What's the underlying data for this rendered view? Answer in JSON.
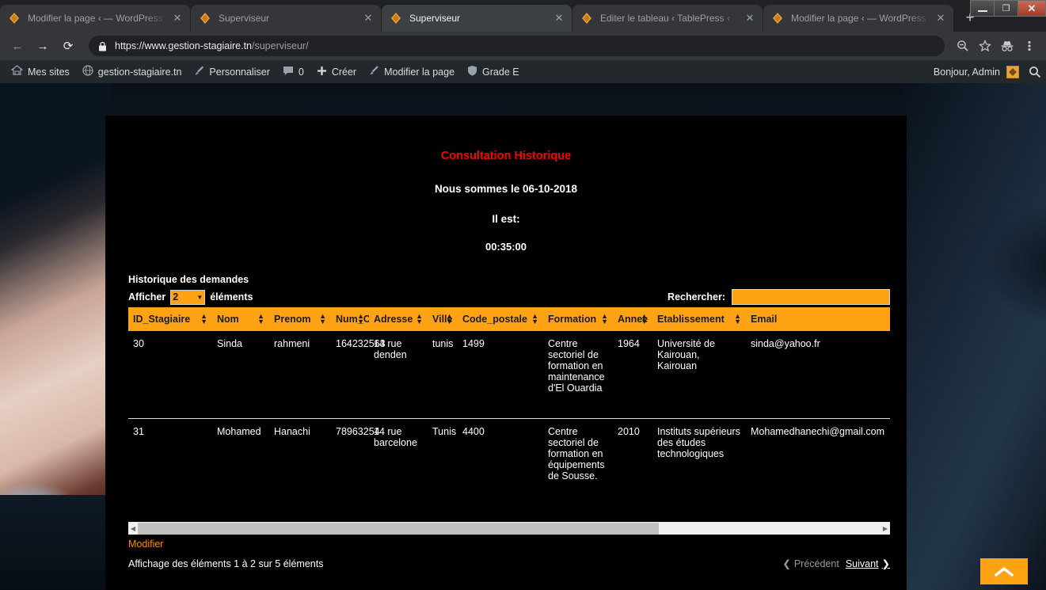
{
  "browser": {
    "tabs": [
      {
        "title": "Modifier la page ‹ — WordPress",
        "active": false,
        "icon": "wordpress-favicon"
      },
      {
        "title": "Superviseur",
        "active": false,
        "icon": "wordpress-favicon"
      },
      {
        "title": "Superviseur",
        "active": true,
        "icon": "wordpress-favicon"
      },
      {
        "title": "Editer le tableau ‹ TablePress ‹",
        "active": false,
        "icon": "wordpress-favicon"
      },
      {
        "title": "Modifier la page ‹ — WordPress",
        "active": false,
        "icon": "wordpress-favicon"
      }
    ],
    "new_tab_label": "+",
    "close_label": "✕",
    "window_controls": {
      "minimize": "—",
      "maximize": "❐",
      "close": "✕"
    },
    "nav": {
      "back": "←",
      "forward": "→",
      "reload": "⟳"
    },
    "url": {
      "scheme_host": "https://www.gestion-stagiaire.tn",
      "path": "/superviseur/"
    },
    "toolbar_icons": [
      "zoom-out-icon",
      "bookmark-star-icon",
      "incognito-icon",
      "chrome-menu-icon"
    ]
  },
  "adminbar": {
    "items": [
      {
        "label": "Mes sites",
        "icon": "wordpress-sites-icon"
      },
      {
        "label": "gestion-stagiaire.tn",
        "icon": "site-icon"
      },
      {
        "label": "Personnaliser",
        "icon": "brush-icon"
      },
      {
        "label": "0",
        "icon": "comment-bubble-icon"
      },
      {
        "label": "Créer",
        "icon": "plus-icon"
      },
      {
        "label": "Modifier la page",
        "icon": "pencil-icon"
      },
      {
        "label": "Grade E",
        "icon": "shield-icon"
      }
    ],
    "greeting": "Bonjour, Admin",
    "avatar_name": "user-avatar",
    "search_icon": "search-icon"
  },
  "page": {
    "title": "Consultation Historique",
    "date_line": "Nous sommes le 06-10-2018",
    "time_label": "Il est:",
    "time_value": "00:35:00",
    "title_color": "#ff0000"
  },
  "table": {
    "caption": "Historique des demandes",
    "length_prefix": "Afficher",
    "length_value": "2",
    "length_suffix": "éléments",
    "search_label": "Rechercher:",
    "search_value": "",
    "search_placeholder": "",
    "columns": [
      "ID_Stagiaire",
      "Nom",
      "Prenom",
      "Num_CIN",
      "Adresse",
      "Ville",
      "Code_postale",
      "Formation",
      "Annee",
      "Etablissement",
      "Email"
    ],
    "rows": [
      {
        "ID_Stagiaire": "30",
        "Nom": "Sinda",
        "Prenom": "rahmeni",
        "Num_CIN": "164232563",
        "Adresse": "14 rue denden",
        "Ville": "tunis",
        "Code_postale": "1499",
        "Formation": "Centre sectoriel de formation en maintenance d'El Ouardia",
        "Annee": "1964",
        "Etablissement": "Université de Kairouan, Kairouan",
        "Email": "sinda@yahoo.fr"
      },
      {
        "ID_Stagiaire": "31",
        "Nom": "Mohamed",
        "Prenom": "Hanachi",
        "Num_CIN": "78963254",
        "Adresse": "14 rue barcelone",
        "Ville": "Tunis",
        "Code_postale": "4400",
        "Formation": "Centre sectoriel de formation en équipements de Sousse.",
        "Annee": "2010",
        "Etablissement": "Instituts supérieurs des études technologiques",
        "Email": "Mohamedhanechi@gmail.com"
      }
    ],
    "modify_link": "Modifier",
    "info": "Affichage des éléments 1 à 2 sur 5 éléments",
    "prev_label": "Précédent",
    "next_label": "Suivant",
    "accent_color": "#ffa314",
    "link_color": "#ff8c00"
  },
  "scroll_top": {
    "name": "scroll-to-top-button",
    "glyph": "chevron-up"
  }
}
